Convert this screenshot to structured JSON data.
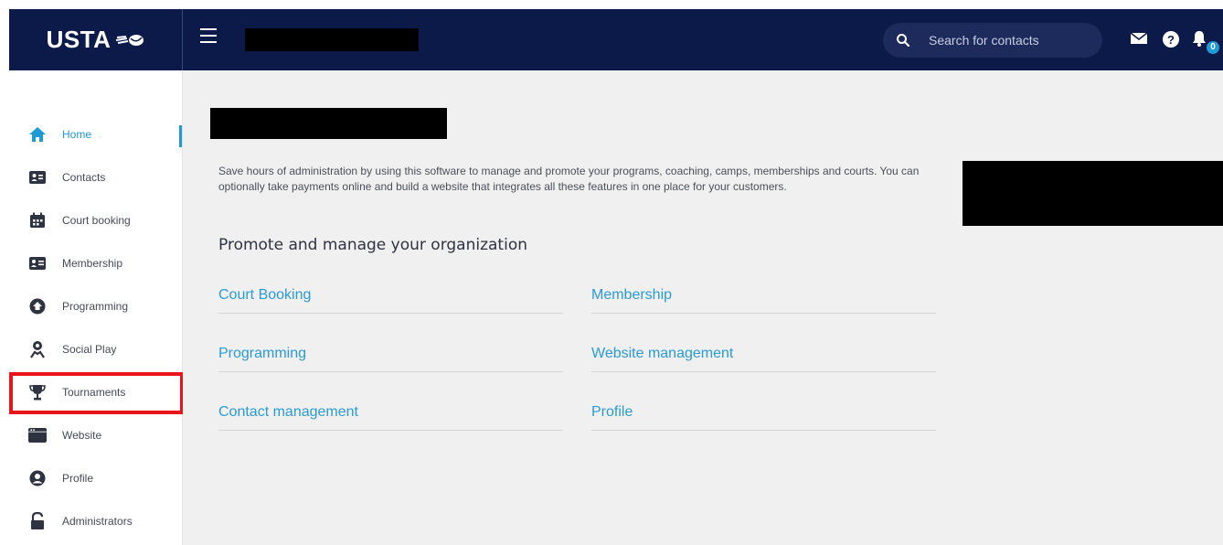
{
  "brand": {
    "logo_text": "USTA"
  },
  "header": {
    "search_placeholder": "Search for contacts",
    "notification_count": "0"
  },
  "sidebar": {
    "items": [
      {
        "label": "Home",
        "icon": "home-icon",
        "active": true
      },
      {
        "label": "Contacts",
        "icon": "contact-card-icon"
      },
      {
        "label": "Court booking",
        "icon": "calendar-icon"
      },
      {
        "label": "Membership",
        "icon": "id-card-icon"
      },
      {
        "label": "Programming",
        "icon": "programming-icon"
      },
      {
        "label": "Social Play",
        "icon": "social-play-icon"
      },
      {
        "label": "Tournaments",
        "icon": "trophy-icon"
      },
      {
        "label": "Website",
        "icon": "browser-window-icon"
      },
      {
        "label": "Profile",
        "icon": "user-circle-icon"
      },
      {
        "label": "Administrators",
        "icon": "lock-icon"
      }
    ]
  },
  "main": {
    "intro": "Save hours of administration by using this software to manage and promote your programs, coaching, camps, memberships and courts. You can optionally take payments online and build a website that integrates all these features in one place for your customers.",
    "section_title": "Promote and manage your organization",
    "links": [
      {
        "label": "Court Booking"
      },
      {
        "label": "Membership"
      },
      {
        "label": "Programming"
      },
      {
        "label": "Website management"
      },
      {
        "label": "Contact management"
      },
      {
        "label": "Profile"
      }
    ]
  },
  "colors": {
    "header_bg": "#0c1a4a",
    "accent": "#1e9ad6",
    "highlight": "#e8161c",
    "main_bg": "#f0f0f0"
  }
}
